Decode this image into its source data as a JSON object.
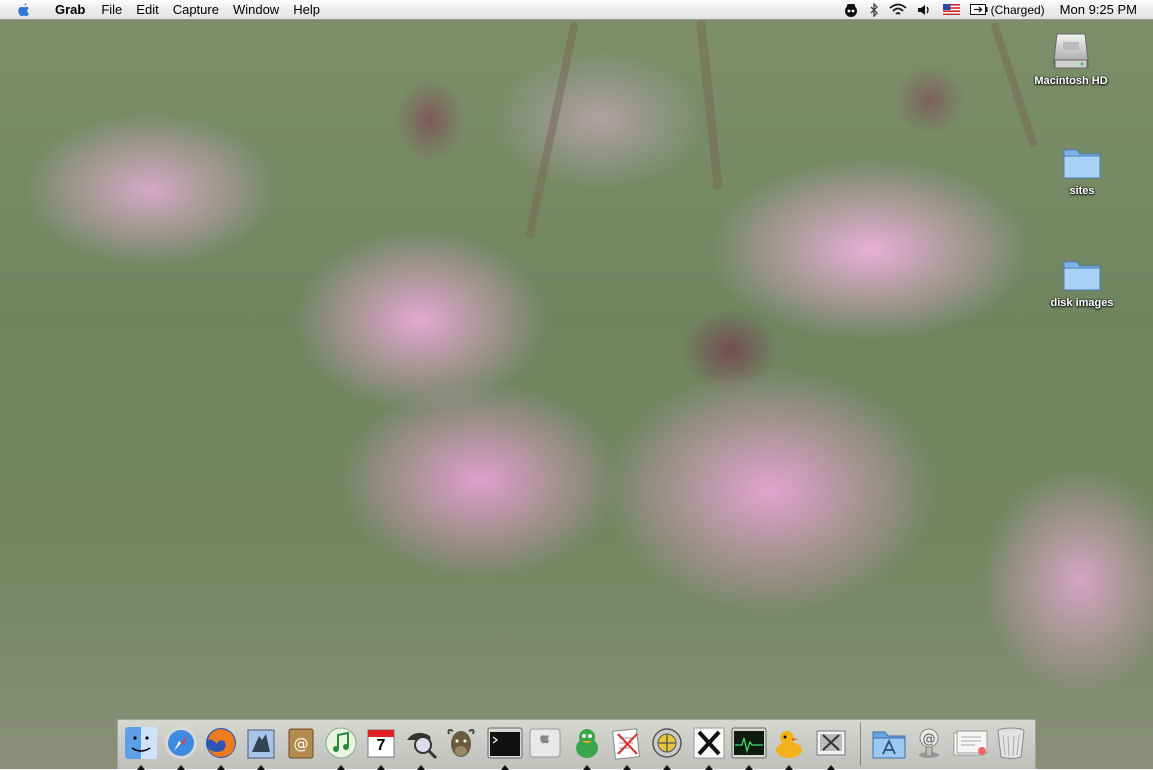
{
  "menubar": {
    "app_name": "Grab",
    "menus": [
      "File",
      "Edit",
      "Capture",
      "Window",
      "Help"
    ],
    "battery_status": "(Charged)",
    "clock": "Mon 9:25 PM",
    "extras": [
      "spy-icon",
      "bluetooth-icon",
      "wifi-icon",
      "volume-icon",
      "us-flag-icon",
      "battery-icon"
    ]
  },
  "desktop_icons": [
    {
      "label": "Macintosh HD",
      "icon": "hard-drive-icon"
    },
    {
      "label": "sites",
      "icon": "folder-icon"
    },
    {
      "label": "disk images",
      "icon": "folder-icon"
    }
  ],
  "dock": {
    "apps": [
      {
        "name": "finder-icon",
        "running": true
      },
      {
        "name": "safari-icon",
        "running": true
      },
      {
        "name": "firefox-icon",
        "running": true
      },
      {
        "name": "mail-icon",
        "running": true
      },
      {
        "name": "address-book-icon",
        "running": false
      },
      {
        "name": "itunes-icon",
        "running": true
      },
      {
        "name": "ical-icon",
        "running": true
      },
      {
        "name": "spotlight-magnifier-icon",
        "running": true
      },
      {
        "name": "gnu-icon",
        "running": false
      },
      {
        "name": "terminal-icon",
        "running": true
      },
      {
        "name": "apple-system-icon",
        "running": false
      },
      {
        "name": "adium-duck-icon",
        "running": true
      },
      {
        "name": "textedit-icon",
        "running": true
      },
      {
        "name": "network-utility-icon",
        "running": true
      },
      {
        "name": "x11-icon",
        "running": true
      },
      {
        "name": "activity-monitor-icon",
        "running": true
      },
      {
        "name": "cyberduck-icon",
        "running": true
      },
      {
        "name": "grab-icon",
        "running": true
      }
    ],
    "right_items": [
      {
        "name": "applications-folder-icon"
      },
      {
        "name": "internet-location-icon"
      },
      {
        "name": "document-stack-icon"
      },
      {
        "name": "trash-icon"
      }
    ],
    "ical_day": "7"
  }
}
